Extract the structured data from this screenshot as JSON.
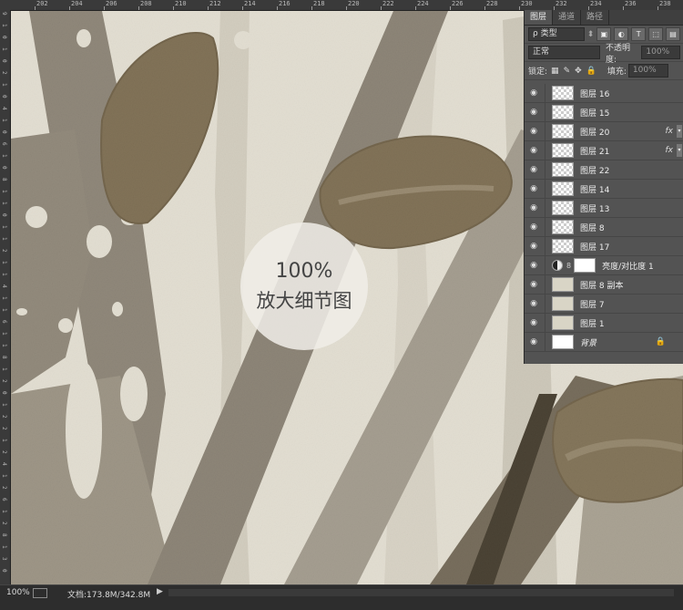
{
  "ruler": {
    "top_labels": [
      "202",
      "204",
      "206",
      "208",
      "210",
      "212",
      "214",
      "216",
      "218",
      "220",
      "222",
      "224",
      "226",
      "228",
      "230",
      "232",
      "234",
      "236",
      "238"
    ],
    "left_labels": [
      "9",
      "1",
      "0",
      "1",
      "0",
      "2",
      "1",
      "0",
      "4",
      "1",
      "0",
      "6",
      "1",
      "0",
      "8",
      "1",
      "1",
      "0",
      "1",
      "1",
      "2",
      "1",
      "1",
      "4",
      "1",
      "1",
      "6",
      "1",
      "1",
      "8",
      "1",
      "2",
      "0",
      "1",
      "2",
      "2",
      "1",
      "2",
      "4",
      "1",
      "2",
      "6",
      "1",
      "2",
      "8",
      "1",
      "3",
      "0"
    ]
  },
  "badge": {
    "line1": "100%",
    "line2": "放大细节图"
  },
  "status": {
    "zoom": "100%",
    "doc": "文档:173.8M/342.8M",
    "arrow": "▶"
  },
  "panel": {
    "tabs": [
      "图层",
      "通道",
      "路径"
    ],
    "filter_kind": "ρ 类型",
    "filter_icons": [
      "▣",
      "◐",
      "T",
      "⬚",
      "▤"
    ],
    "blend_mode": "正常",
    "opacity_label": "不透明度:",
    "opacity_value": "100%",
    "lock_label": "锁定:",
    "lock_icons": [
      "▦",
      "✎",
      "✥",
      "🔒"
    ],
    "fill_label": "填充:",
    "fill_value": "100%",
    "layers": [
      {
        "name": "图层 16",
        "thumb": "checker",
        "fx": false
      },
      {
        "name": "图层 15",
        "thumb": "checker",
        "fx": false
      },
      {
        "name": "图层 20",
        "thumb": "checker",
        "fx": true
      },
      {
        "name": "图层 21",
        "thumb": "checker",
        "fx": true
      },
      {
        "name": "图层 22",
        "thumb": "checker",
        "fx": false
      },
      {
        "name": "图层 14",
        "thumb": "checker",
        "fx": false
      },
      {
        "name": "图层 13",
        "thumb": "checker",
        "fx": false
      },
      {
        "name": "图层 8",
        "thumb": "checker",
        "fx": false
      },
      {
        "name": "图层 17",
        "thumb": "checker",
        "fx": false
      },
      {
        "name": "亮度/对比度 1",
        "thumb": "adjust",
        "fx": false
      },
      {
        "name": "图层 8 副本",
        "thumb": "texture",
        "fx": false
      },
      {
        "name": "图层 7",
        "thumb": "texture",
        "fx": false
      },
      {
        "name": "图层 1",
        "thumb": "texture",
        "fx": false
      },
      {
        "name": "背景",
        "thumb": "white",
        "fx": false,
        "locked": true
      }
    ],
    "fx_label": "fx",
    "lock_glyph": "🔒"
  },
  "colors": {
    "leaf": "#7a6a4e",
    "branch": "#8d8577",
    "paper": "#e6e2d6",
    "panel": "#535353"
  }
}
